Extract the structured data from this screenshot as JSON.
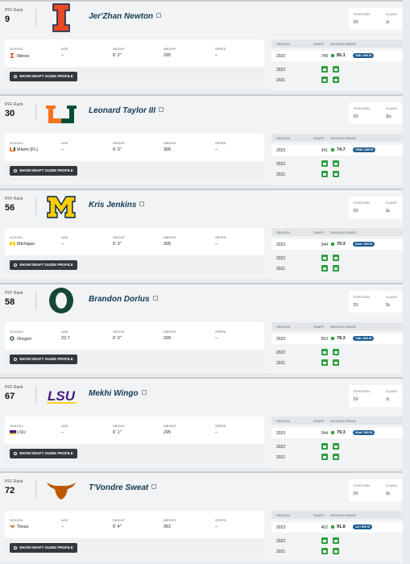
{
  "labels": {
    "pff_rank": "PFF Rank",
    "position": "POSITION",
    "class": "CLASS",
    "school": "SCHOOL",
    "age": "AGE",
    "height": "HEIGHT",
    "weight": "WEIGHT",
    "speed": "SPEED",
    "season": "SEASON",
    "snaps": "SNAPS",
    "season_grade": "SEASON GRADE",
    "show_profile": "SHOW DRAFT GUIDE PROFILE"
  },
  "colors": {
    "name_text": "#143a55",
    "grade_dot": "#2e9e42",
    "rank_pill": "#1d5b8e",
    "locked_grade": "#2e9e42",
    "button": "#32393e"
  },
  "players": [
    {
      "rank": "9",
      "name": "Jer'Zhan Newton",
      "logo": "illinois-logo",
      "position": "DI",
      "class": "Jr.",
      "school": "Illinois",
      "age": "–",
      "height": "6' 2\"",
      "weight": "295",
      "speed": "–",
      "seasons": [
        {
          "season": "2023",
          "snaps": "749",
          "grade": "85.1",
          "grade_rank": "10th / 899 DI"
        },
        {
          "season": "2022"
        },
        {
          "season": "2021"
        }
      ]
    },
    {
      "rank": "30",
      "name": "Leonard Taylor III",
      "logo": "miami-logo",
      "position": "DI",
      "class": "So.",
      "school": "Miami (FL)",
      "age": "–",
      "height": "6' 3\"",
      "weight": "305",
      "speed": "–",
      "seasons": [
        {
          "season": "2023",
          "snaps": "341",
          "grade": "74.7",
          "grade_rank": "150th / 899 DI"
        },
        {
          "season": "2022"
        },
        {
          "season": "2021"
        }
      ]
    },
    {
      "rank": "56",
      "name": "Kris Jenkins",
      "logo": "michigan-logo",
      "position": "DI",
      "class": "Sr.",
      "school": "Michigan",
      "age": "–",
      "height": "6' 3\"",
      "weight": "305",
      "speed": "–",
      "seasons": [
        {
          "season": "2023",
          "snaps": "344",
          "grade": "79.3",
          "grade_rank": "62nd / 899 DI"
        },
        {
          "season": "2022"
        },
        {
          "season": "2021"
        }
      ]
    },
    {
      "rank": "58",
      "name": "Brandon Dorlus",
      "logo": "oregon-logo",
      "position": "DI",
      "class": "Sr.",
      "school": "Oregon",
      "age": "22.7",
      "height": "6' 3\"",
      "weight": "290",
      "speed": "–",
      "seasons": [
        {
          "season": "2023",
          "snaps": "563",
          "grade": "78.3",
          "grade_rank": "74th / 899 DI"
        },
        {
          "season": "2022"
        },
        {
          "season": "2021"
        }
      ]
    },
    {
      "rank": "67",
      "name": "Mekhi Wingo",
      "logo": "lsu-logo",
      "position": "DI",
      "class": "Jr.",
      "school": "LSU",
      "age": "–",
      "height": "6' 1\"",
      "weight": "295",
      "speed": "–",
      "seasons": [
        {
          "season": "2023",
          "snaps": "344",
          "grade": "79.3",
          "grade_rank": "62nd / 899 DI"
        },
        {
          "season": "2022"
        },
        {
          "season": "2021"
        }
      ]
    },
    {
      "rank": "72",
      "name": "T'Vondre Sweat",
      "logo": "texas-logo",
      "position": "DI",
      "class": "Sr.",
      "school": "Texas",
      "age": "–",
      "height": "6' 4\"",
      "weight": "362",
      "speed": "–",
      "seasons": [
        {
          "season": "2023",
          "snaps": "462",
          "grade": "91.8",
          "grade_rank": "1st / 899 DI"
        },
        {
          "season": "2022"
        },
        {
          "season": "2021"
        }
      ]
    }
  ]
}
